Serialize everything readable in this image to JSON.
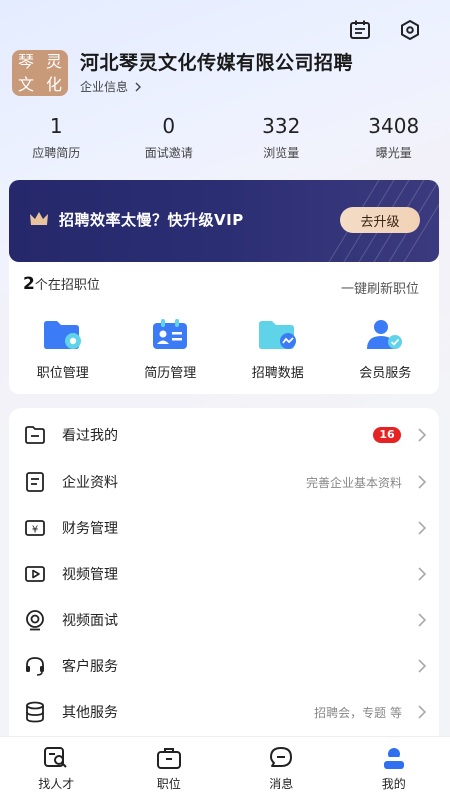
{
  "header": {
    "icons": [
      "calendar-icon",
      "settings-hex-icon"
    ]
  },
  "company": {
    "logo_chars": [
      "琴",
      "灵",
      "文",
      "化"
    ],
    "logo_color": "#c99a7a",
    "name": "河北琴灵文化传媒有限公司招聘",
    "info_link": "企业信息"
  },
  "stats": [
    {
      "value": "1",
      "label": "应聘简历"
    },
    {
      "value": "0",
      "label": "面试邀请"
    },
    {
      "value": "332",
      "label": "浏览量"
    },
    {
      "value": "3408",
      "label": "曝光量"
    }
  ],
  "vip": {
    "text": "招聘效率太慢？快升级VIP",
    "button": "去升级",
    "bg_color": "#26286b"
  },
  "jobs": {
    "count": "2",
    "count_label": "个在招职位",
    "refresh": "一键刷新职位",
    "items": [
      {
        "label": "职位管理",
        "icon": "folder-eye-icon"
      },
      {
        "label": "简历管理",
        "icon": "resume-card-icon"
      },
      {
        "label": "招聘数据",
        "icon": "folder-chart-icon"
      },
      {
        "label": "会员服务",
        "icon": "member-badge-icon"
      }
    ]
  },
  "menu": [
    {
      "label": "看过我的",
      "badge": "16",
      "hint": "",
      "icon": "folder-viewed-icon"
    },
    {
      "label": "企业资料",
      "badge": "",
      "hint": "完善企业基本资料",
      "icon": "document-icon"
    },
    {
      "label": "财务管理",
      "badge": "",
      "hint": "",
      "icon": "yuan-icon"
    },
    {
      "label": "视频管理",
      "badge": "",
      "hint": "",
      "icon": "video-play-icon"
    },
    {
      "label": "视频面试",
      "badge": "",
      "hint": "",
      "icon": "camera-icon"
    },
    {
      "label": "客户服务",
      "badge": "",
      "hint": "",
      "icon": "headset-icon"
    },
    {
      "label": "其他服务",
      "badge": "",
      "hint": "招聘会，专题 等",
      "icon": "database-icon"
    }
  ],
  "tabs": [
    {
      "label": "找人才",
      "icon": "search-people-icon"
    },
    {
      "label": "职位",
      "icon": "briefcase-icon"
    },
    {
      "label": "消息",
      "icon": "chat-icon"
    },
    {
      "label": "我的",
      "icon": "profile-icon"
    }
  ],
  "colors": {
    "accent": "#3b7bf5",
    "badge": "#e62222"
  }
}
